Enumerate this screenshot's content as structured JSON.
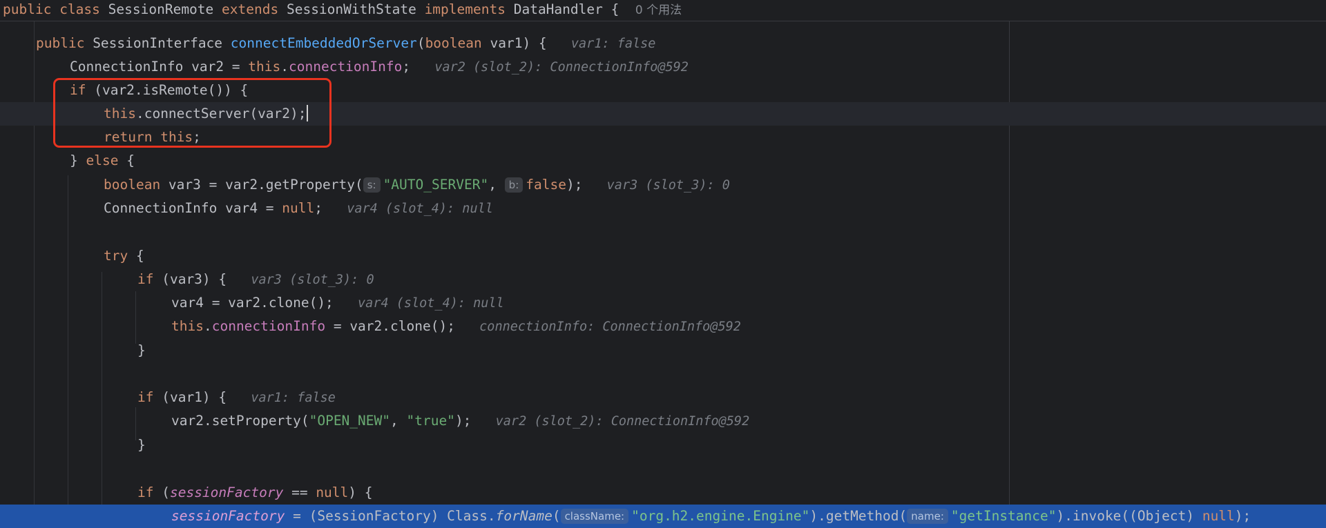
{
  "header": {
    "public": "public",
    "class": "class",
    "class_name": "SessionRemote",
    "extends": "extends",
    "super_name": "SessionWithState",
    "implements": "implements",
    "iface": "DataHandler",
    "brace": "{",
    "usages": "0 个用法"
  },
  "lines": {
    "l1": {
      "kw_public": "public",
      "type": " SessionInterface ",
      "method": "connectEmbeddedOrServer",
      "open": "(",
      "kw_boolean": "boolean",
      "rest": " var1) {",
      "hint": "var1: false"
    },
    "l2": {
      "code": "ConnectionInfo var2 = ",
      "kw_this": "this",
      "dot": ".",
      "field": "connectionInfo",
      "end": ";",
      "hint": "var2 (slot_2): ConnectionInfo@592"
    },
    "l3": {
      "kw_if": "if",
      "rest": " (var2.isRemote()) {"
    },
    "l4": {
      "kw_this": "this",
      "rest": ".connectServer(var2);"
    },
    "l5": {
      "kw_return": "return",
      "sp": " ",
      "kw_this": "this",
      "end": ";"
    },
    "l6": {
      "brace": "} ",
      "kw_else": "else",
      "rest": " {"
    },
    "l7": {
      "kw_boolean": "boolean",
      "code": " var3 = var2.getProperty(",
      "hint_s": "s:",
      "str": "\"AUTO_SERVER\"",
      "comma": ", ",
      "hint_b": "b:",
      "kw_false": "false",
      "end": ");",
      "hint": "var3 (slot_3): 0"
    },
    "l8": {
      "code": "ConnectionInfo var4 = ",
      "kw_null": "null",
      "end": ";",
      "hint": "var4 (slot_4): null"
    },
    "l10": {
      "kw_try": "try",
      "rest": " {"
    },
    "l11": {
      "kw_if": "if",
      "rest": " (var3) {",
      "hint": "var3 (slot_3): 0"
    },
    "l12": {
      "code": "var4 = var2.clone();",
      "hint": "var4 (slot_4): null"
    },
    "l13": {
      "kw_this": "this",
      "dot": ".",
      "field": "connectionInfo",
      "rest": " = var2.clone();",
      "hint": "connectionInfo: ConnectionInfo@592"
    },
    "l14": {
      "brace": "}"
    },
    "l16": {
      "kw_if": "if",
      "rest": " (var1) {",
      "hint": "var1: false"
    },
    "l17": {
      "code": "var2.setProperty(",
      "str1": "\"OPEN_NEW\"",
      "comma": ", ",
      "str2": "\"true\"",
      "end": ");",
      "hint": "var2 (slot_2): ConnectionInfo@592"
    },
    "l18": {
      "brace": "}"
    },
    "l20": {
      "kw_if": "if",
      "open": " (",
      "static": "sessionFactory",
      "mid": " == ",
      "kw_null": "null",
      "end": ") {"
    },
    "l21": {
      "static": "sessionFactory",
      "code1": " = (SessionFactory) Class.",
      "call": "forName",
      "open": "(",
      "hint_class": "className:",
      "str1": "\"org.h2.engine.Engine\"",
      "code2": ").getMethod(",
      "hint_name": "name:",
      "str2": "\"getInstance\"",
      "code3": ").invoke((Object) ",
      "kw_null": "null",
      "end": ");"
    }
  }
}
